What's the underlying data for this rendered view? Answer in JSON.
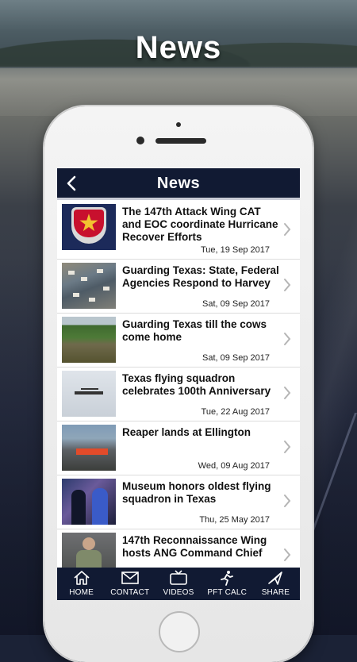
{
  "page": {
    "title": "News"
  },
  "app_bar": {
    "title": "News",
    "back_icon": "chevron-left-icon"
  },
  "news": [
    {
      "title": "The 147th Attack Wing CAT and EOC coordinate Hurricane Recover Efforts",
      "date": "Tue, 19 Sep 2017",
      "thumb": "wing-emblem"
    },
    {
      "title": "Guarding Texas: State, Federal Agencies Respond to Harvey",
      "date": "Sat, 09 Sep 2017",
      "thumb": "flood-aerial"
    },
    {
      "title": "Guarding Texas till the cows come home",
      "date": "Sat, 09 Sep 2017",
      "thumb": "river-aerial"
    },
    {
      "title": "Texas flying squadron celebrates 100th Anniversary",
      "date": "Tue, 22 Aug 2017",
      "thumb": "aircraft"
    },
    {
      "title": "Reaper lands at Ellington",
      "date": "Wed, 09 Aug 2017",
      "thumb": "reaper"
    },
    {
      "title": "Museum honors oldest flying squadron in Texas",
      "date": "Thu, 25 May 2017",
      "thumb": "museum"
    },
    {
      "title": "147th Reconnaissance Wing hosts ANG Command Chief",
      "date": "",
      "thumb": "officer"
    }
  ],
  "tabs": [
    {
      "label": "HOME",
      "icon": "home-icon"
    },
    {
      "label": "CONTACT",
      "icon": "mail-icon"
    },
    {
      "label": "VIDEOS",
      "icon": "tv-icon"
    },
    {
      "label": "PFT CALC",
      "icon": "runner-icon"
    },
    {
      "label": "SHARE",
      "icon": "share-icon"
    }
  ],
  "colors": {
    "navy": "#111a33",
    "chevron": "#b5b5b5"
  }
}
